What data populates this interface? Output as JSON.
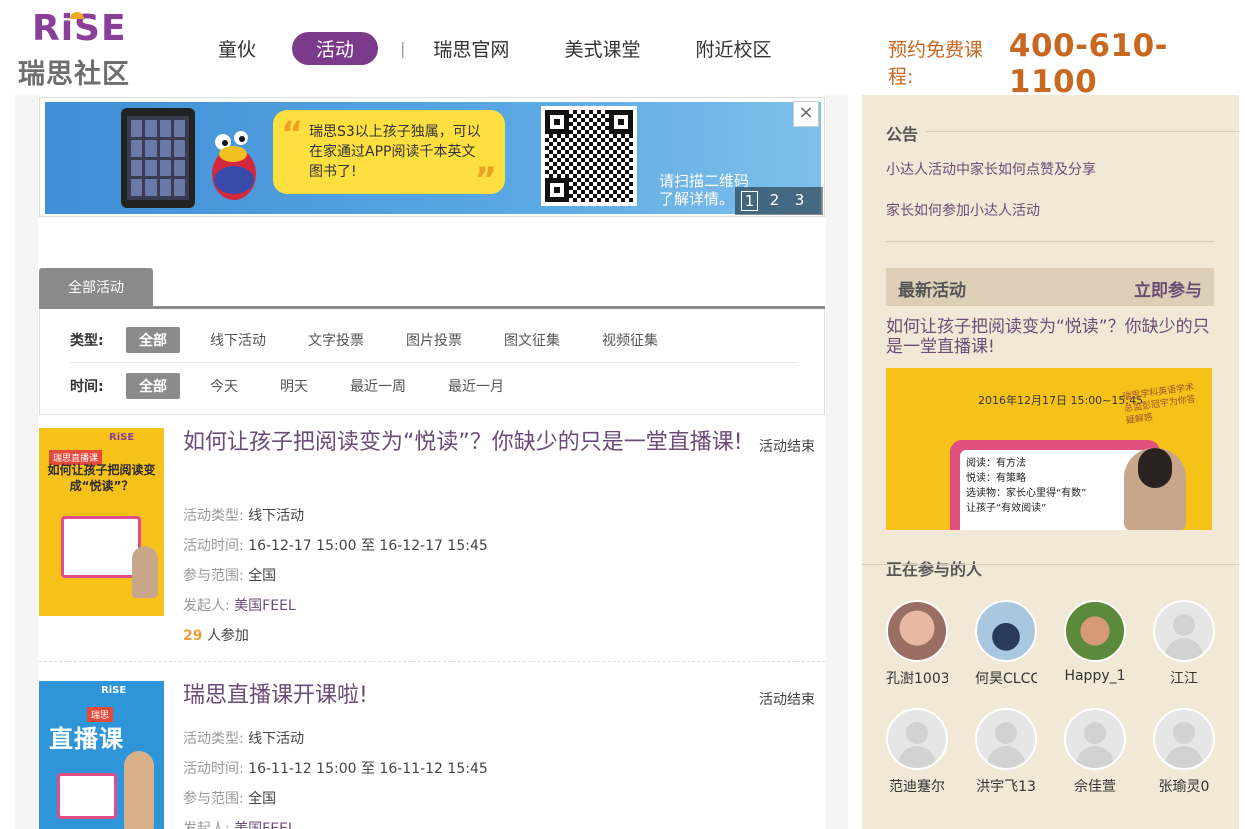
{
  "header": {
    "logo_en": "RiSE",
    "logo_cn": "瑞思社区",
    "nav": [
      {
        "label": "童伙"
      },
      {
        "label": "活动"
      },
      {
        "label": "瑞思官网"
      },
      {
        "label": "美式课堂"
      },
      {
        "label": "附近校区"
      }
    ],
    "nav_separator": "|",
    "hotline_label": "预约免费课程:",
    "hotline_number": "400-610-1100"
  },
  "banner": {
    "bubble_text": "瑞思S3以上孩子独属，可以在家通过APP阅读千本英文图书了!",
    "scan_text_line1": "请扫描二维码",
    "scan_text_line2": "了解详情。",
    "close_label": "×",
    "pages": [
      "1",
      "2",
      "3"
    ]
  },
  "tabs": {
    "active": "全部活动"
  },
  "filters": {
    "type_label": "类型:",
    "type_options": [
      "全部",
      "线下活动",
      "文字投票",
      "图片投票",
      "图文征集",
      "视频征集"
    ],
    "time_label": "时间:",
    "time_options": [
      "全部",
      "今天",
      "明天",
      "最近一周",
      "最近一月"
    ]
  },
  "activities": [
    {
      "title": "如何让孩子把阅读变为“悦读”？你缺少的只是一堂直播课!",
      "status": "活动结束",
      "type_label": "活动类型:",
      "type_value": "线下活动",
      "time_label": "活动时间:",
      "time_value": "16-12-17 15:00 至 16-12-17 15:45",
      "scope_label": "参与范围:",
      "scope_value": "全国",
      "initiator_label": "发起人:",
      "initiator_value": "美国FEEL",
      "count": "29",
      "count_suffix": "人参加",
      "poster_brand": "RiSE",
      "poster_tag": "瑞思直播课",
      "poster_title": "如何让孩子把阅读变成“悦读”？"
    },
    {
      "title": "瑞思直播课开课啦!",
      "status": "活动结束",
      "type_label": "活动类型:",
      "type_value": "线下活动",
      "time_label": "活动时间:",
      "time_value": "16-11-12 15:00 至 16-11-12 15:45",
      "scope_label": "参与范围:",
      "scope_value": "全国",
      "initiator_label": "发起人:",
      "initiator_value": "美国FEEL",
      "poster_brand": "RiSE",
      "poster_tag": "瑞思",
      "poster_title": "直播课"
    }
  ],
  "sidebar": {
    "notice_heading": "公告",
    "notices": [
      "小达人活动中家长如何点赞及分享",
      "家长如何参加小达人活动"
    ],
    "latest_heading": "最新活动",
    "latest_join": "立即参与",
    "latest_title": "如何让孩子把阅读变为“悦读”？你缺少的只是一堂直播课!",
    "latest_img_date": "2016年12月17日 15:00~15:45",
    "latest_img_lines": [
      "阅读：有方法",
      "悦读：有策略",
      "选读物：家长心里得“有数”",
      "让孩子“有效阅读”"
    ],
    "latest_img_note": "瑞思学科英语学术总监彭冠宇为你答疑解惑",
    "participants_heading": "正在参与的人",
    "participants": [
      {
        "name": "孔澍1003",
        "avatar": "photo"
      },
      {
        "name": "何昊CLCC",
        "avatar": "photo"
      },
      {
        "name": "Happy_1",
        "avatar": "photo"
      },
      {
        "name": "江江",
        "avatar": "default"
      },
      {
        "name": "范迪蹇尔",
        "avatar": "default"
      },
      {
        "name": "洪宇飞13",
        "avatar": "default"
      },
      {
        "name": "佘佳萱",
        "avatar": "default"
      },
      {
        "name": "张瑜灵0",
        "avatar": "default"
      }
    ]
  }
}
